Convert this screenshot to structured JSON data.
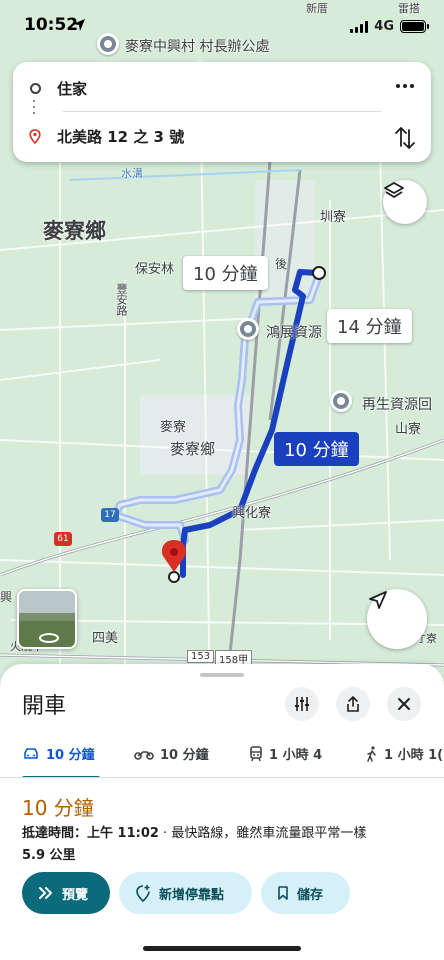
{
  "status_bar": {
    "time": "10:52",
    "network": "4G"
  },
  "route": {
    "origin": "住家",
    "destination": "北美路 12 之 3 號"
  },
  "map": {
    "poi_top": "麥寮中興村 村長辦公處",
    "poi_recycle1": "鴻展資源",
    "poi_recycle2": "再生資源回",
    "township": "麥寮鄉",
    "labels": {
      "baoanlin": "保安林",
      "fengan": "豐安路",
      "mailiao_small": "麥寮",
      "mailiao_town": "麥寮鄉",
      "xinghua": "興化寮",
      "zhenliao": "圳寮",
      "shanliao": "山寮",
      "simei": "四美",
      "shuilu": "水溝",
      "hou": "後",
      "xing": "興",
      "huo": "火燒千",
      "cailiao": "才寮",
      "leiliao": "雷搭",
      "xingliao": "新厝"
    },
    "road_badges": {
      "a": "17",
      "b": "61",
      "c": "153",
      "d": "158甲"
    },
    "durations": {
      "alt1": "10 分鐘",
      "alt2": "14 分鐘",
      "main": "10 分鐘"
    }
  },
  "sheet": {
    "title": "開車",
    "modes": [
      {
        "label": "10 分鐘",
        "icon": "car-icon"
      },
      {
        "label": "10 分鐘",
        "icon": "motorcycle-icon"
      },
      {
        "label": "1 小時 4",
        "icon": "transit-icon"
      },
      {
        "label": "1 小時 1(",
        "icon": "walk-icon"
      }
    ],
    "eta": "10 分鐘",
    "arrival_prefix": "抵達時間：上午 11:02",
    "arrival_suffix": " · 最快路線，雖然車流量跟平常一樣",
    "distance": "5.9 公里",
    "buttons": {
      "preview": "預覽",
      "add_stop": "新增停靠點",
      "save": "儲存"
    }
  },
  "colors": {
    "route_main": "#1a3fbf",
    "route_alt": "#a9c0f0",
    "eta": "#b06000",
    "primary_button": "#0b6b7b",
    "secondary_button": "#d5f0f6",
    "map_bg": "#d6ecd9"
  }
}
